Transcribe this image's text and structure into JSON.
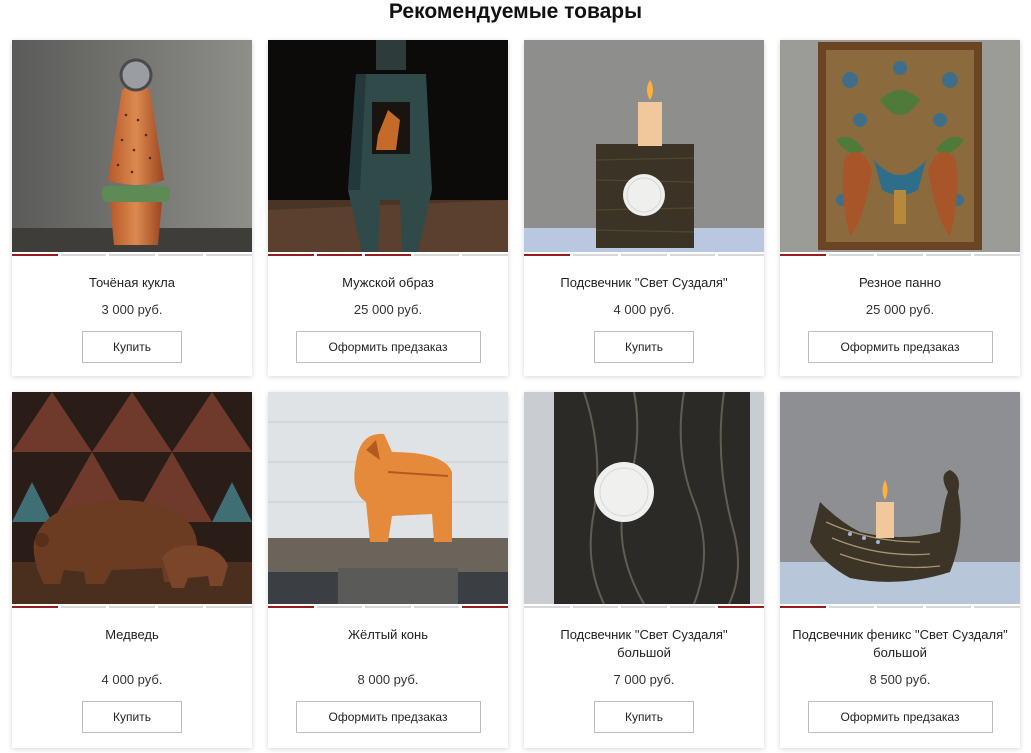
{
  "section": {
    "title": "Рекомендуемые товары"
  },
  "products": [
    {
      "name": "Точёная кукла",
      "price": "3 000 руб.",
      "button": "Купить"
    },
    {
      "name": "Мужской образ",
      "price": "25 000 руб.",
      "button": "Оформить предзаказ"
    },
    {
      "name": "Подсвечник \"Свет Суздаля\"",
      "price": "4 000 руб.",
      "button": "Купить"
    },
    {
      "name": "Резное панно",
      "price": "25 000 руб.",
      "button": "Оформить предзаказ"
    },
    {
      "name": "Медведь",
      "price": "4 000 руб.",
      "button": "Купить"
    },
    {
      "name": "Жёлтый конь",
      "price": "8 000 руб.",
      "button": "Оформить предзаказ"
    },
    {
      "name": "Подсвечник \"Свет Суздаля\" большой",
      "price": "7 000 руб.",
      "button": "Купить"
    },
    {
      "name": "Подсвечник феникс \"Свет Суздаля\" большой",
      "price": "8 500 руб.",
      "button": "Оформить предзаказ"
    }
  ],
  "colors": {
    "accent": "#9b1c1c",
    "dot": "#d7d7d7",
    "border": "#bdbdbd"
  }
}
